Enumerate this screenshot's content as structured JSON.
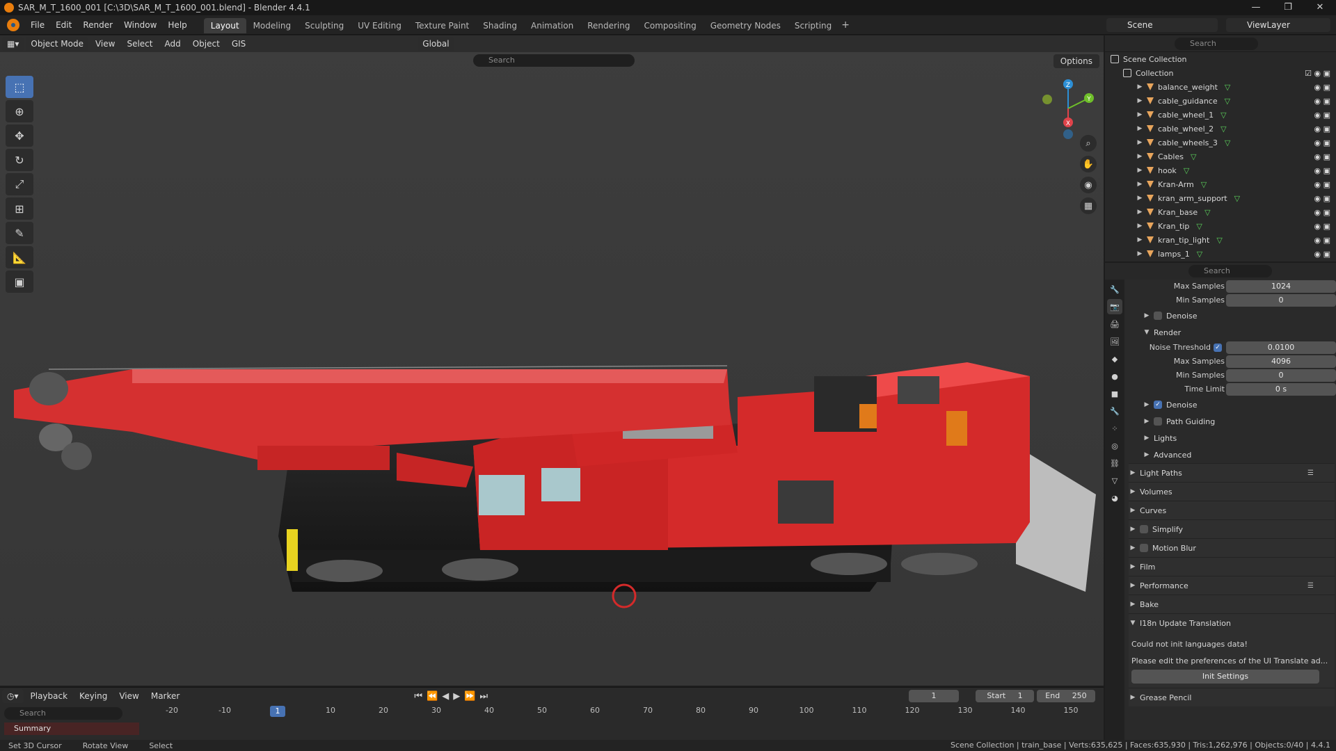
{
  "window": {
    "title": "SAR_M_T_1600_001 [C:\\3D\\SAR_M_T_1600_001.blend] - Blender 4.4.1",
    "controls": [
      "—",
      "❐",
      "✕"
    ]
  },
  "menu": [
    "File",
    "Edit",
    "Render",
    "Window",
    "Help"
  ],
  "workspaces": [
    "Layout",
    "Modeling",
    "Sculpting",
    "UV Editing",
    "Texture Paint",
    "Shading",
    "Animation",
    "Rendering",
    "Compositing",
    "Geometry Nodes",
    "Scripting"
  ],
  "active_workspace": "Layout",
  "scene_name": "Scene",
  "view_layer": "ViewLayer",
  "viewport": {
    "mode": "Object Mode",
    "menus": [
      "View",
      "Select",
      "Add",
      "Object",
      "GIS"
    ],
    "transform_orientation": "Global",
    "search_placeholder": "Search",
    "options_label": "Options",
    "gizmo_axes": [
      "Z",
      "Y",
      "X"
    ]
  },
  "outliner": {
    "search_placeholder": "Search",
    "scene_collection": "Scene Collection",
    "collection": "Collection",
    "objects": [
      "balance_weight",
      "cable_guidance",
      "cable_wheel_1",
      "cable_wheel_2",
      "cable_wheels_3",
      "Cables",
      "hook",
      "Kran-Arm",
      "kran_arm_support",
      "Kran_base",
      "Kran_tip",
      "kran_tip_light",
      "lamps_1"
    ]
  },
  "properties": {
    "search_placeholder": "Search",
    "top_rows": [
      {
        "label": "Max Samples",
        "value": "1024"
      },
      {
        "label": "Min Samples",
        "value": "0"
      }
    ],
    "denoise_label": "Denoise",
    "render_label": "Render",
    "noise_threshold": {
      "label": "Noise Threshold",
      "value": "0.0100"
    },
    "render_rows": [
      {
        "label": "Max Samples",
        "value": "4096"
      },
      {
        "label": "Min Samples",
        "value": "0"
      },
      {
        "label": "Time Limit",
        "value": "0 s"
      }
    ],
    "sub_panels": [
      "Denoise",
      "Path Guiding",
      "Lights",
      "Advanced"
    ],
    "sections": [
      "Light Paths",
      "Volumes",
      "Curves",
      "Simplify",
      "Motion Blur",
      "Film",
      "Performance",
      "Bake"
    ],
    "i18n": {
      "title": "I18n Update Translation",
      "line1": "Could not init languages data!",
      "line2": "Please edit the preferences of the UI Translate ad...",
      "button": "Init Settings"
    },
    "grease_pencil": "Grease Pencil"
  },
  "timeline": {
    "menus": [
      "Playback",
      "Keying",
      "View",
      "Marker"
    ],
    "current_frame": "1",
    "start_label": "Start",
    "start": "1",
    "end_label": "End",
    "end": "250",
    "search_placeholder": "Search",
    "summary": "Summary",
    "ticks": [
      "-20",
      "-10",
      "1",
      "10",
      "20",
      "30",
      "40",
      "50",
      "60",
      "70",
      "80",
      "90",
      "100",
      "110",
      "120",
      "130",
      "140",
      "150"
    ]
  },
  "status": {
    "left": [
      "Set 3D Cursor",
      "Rotate View",
      "Select"
    ],
    "right": "Scene Collection | train_base | Verts:635,625 | Faces:635,930 | Tris:1,262,976 | Objects:0/40 | ",
    "version": "4.4.1"
  },
  "colors": {
    "accent": "#4772b3",
    "crane_red": "#d42a2a",
    "viewport_bg": "#3a3a3a",
    "orange": "#e87d0d"
  }
}
